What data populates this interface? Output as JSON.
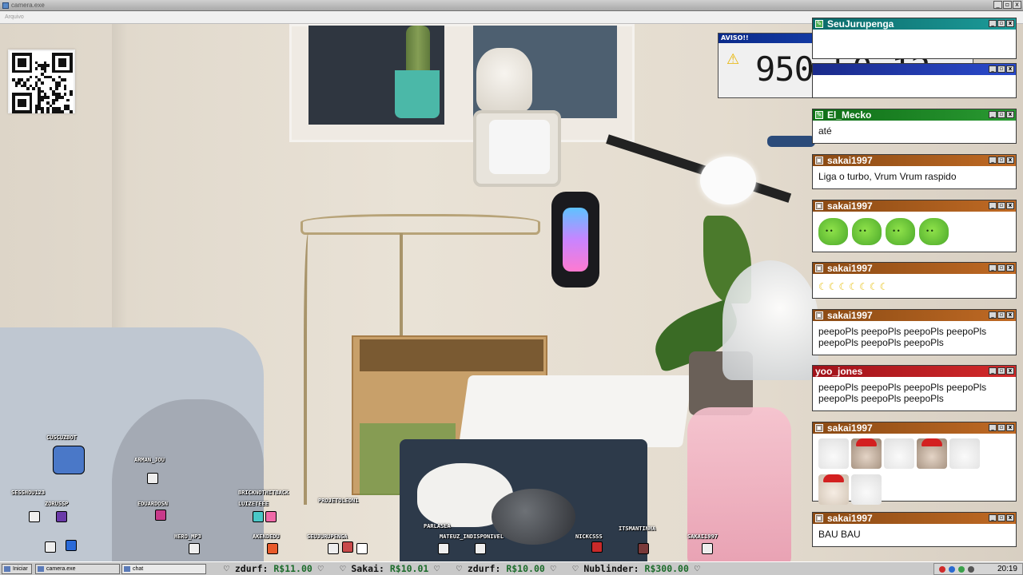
{
  "window": {
    "title": "camera.exe",
    "menu_item": "Arquivo",
    "controls": [
      "_",
      "▫",
      "x"
    ]
  },
  "aviso": {
    "title": "AVISO!!",
    "close": "x",
    "icon": "warning-icon",
    "timer": "950:50:12"
  },
  "chat": {
    "messages": [
      {
        "user": "SeuJurupenga",
        "text": "",
        "color": "teal",
        "badge": "edit-icon"
      },
      {
        "user": "",
        "text": "",
        "color": "blue",
        "badge": ""
      },
      {
        "user": "El_Mecko",
        "text": "até",
        "color": "green",
        "badge": "edit-icon"
      },
      {
        "user": "sakai1997",
        "text": "Liga o turbo, Vrum Vrum raspido",
        "color": "orange",
        "badge": "gift-icon"
      },
      {
        "user": "sakai1997",
        "text": "",
        "emotes": [
          "green-blob-emote",
          "green-blob-emote",
          "green-blob-emote",
          "green-blob-emote"
        ],
        "color": "orange",
        "badge": "gift-icon"
      },
      {
        "user": "sakai1997",
        "text": "",
        "emotes": [
          "banana-emote",
          "banana-emote",
          "banana-emote",
          "banana-emote",
          "banana-emote",
          "banana-emote",
          "banana-emote"
        ],
        "color": "orange",
        "badge": "gift-icon"
      },
      {
        "user": "sakai1997",
        "text": "peepoPls peepoPls peepoPls peepoPls peepoPls peepoPls peepoPls",
        "color": "orange",
        "badge": "gift-icon"
      },
      {
        "user": "yoo_jones",
        "text": "peepoPls peepoPls peepoPls peepoPls peepoPls peepoPls peepoPls",
        "color": "red",
        "badge": ""
      },
      {
        "user": "sakai1997",
        "text": "",
        "emotes": [
          "chicken-emote",
          "santa-hamster-emote",
          "chicken-emote",
          "santa-hamster-emote",
          "chicken-emote",
          "santa-hamster-emote",
          "chicken-emote"
        ],
        "color": "orange",
        "badge": "gift-icon"
      },
      {
        "user": "sakai1997",
        "text": "BAU BAU",
        "color": "orange",
        "badge": "gift-icon"
      }
    ]
  },
  "viewers": [
    "CUSCUZBOT",
    "ARMAN_JOU",
    "SESSHOU123",
    "ZORUSSP",
    "EDUARDOSN",
    "BRICKNOTHITBACK",
    "LUIZETEEE",
    "PROJETOLEON1",
    "HERO_MP3",
    "AKENDEDU",
    "SEUJURUPENGA",
    "PARLASEA",
    "MATEUZ_INDISPONIVEL",
    "NICKCSSS",
    "ITSMANTINHA",
    "SAKAI1997"
  ],
  "taskbar": {
    "start_label": "Iniciar",
    "tasks": [
      "camera.exe",
      "chat"
    ],
    "ticker": [
      {
        "name": "zdurf:",
        "amount": "R$11.00"
      },
      {
        "name": "Sakai:",
        "amount": "R$10.01"
      },
      {
        "name": "zdurf:",
        "amount": "R$10.00"
      },
      {
        "name": "Nublinder:",
        "amount": "R$300.00"
      }
    ],
    "clock": "20:19"
  },
  "colors": {
    "chat_green": "#1a8a22",
    "chat_orange": "#a85a1c",
    "chat_red": "#c01e22",
    "donation_amount": "#1b6b2a"
  }
}
